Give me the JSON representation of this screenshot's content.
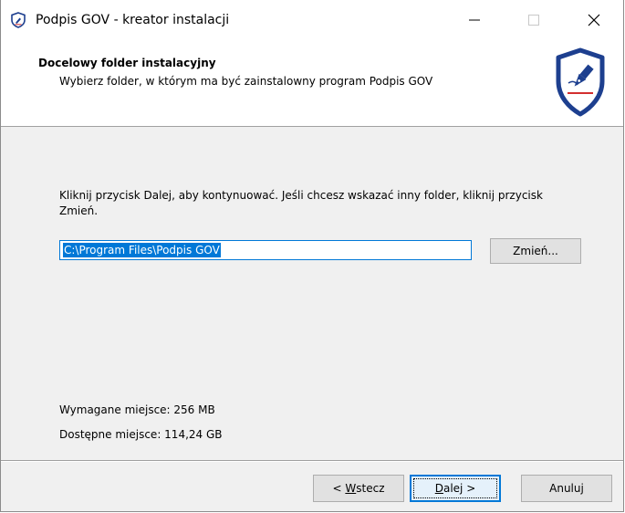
{
  "window": {
    "title": "Podpis GOV - kreator instalacji",
    "minimize_glyph": "—",
    "maximize_glyph": "☐",
    "close_glyph": "✕"
  },
  "header": {
    "title": "Docelowy folder instalacyjny",
    "subtitle": "Wybierz folder, w którym ma być zainstalowny program Podpis GOV",
    "logo_icon": "shield-pen-icon"
  },
  "content": {
    "instruction": "Kliknij przycisk Dalej, aby kontynuować. Jeśli chcesz wskazać inny folder, kliknij przycisk Zmień.",
    "install_path": "C:\\Program Files\\Podpis GOV",
    "change_button": "Zmień...",
    "space_required": "Wymagane miejsce: 256 MB",
    "space_available": "Dostępne miejsce: 114,24 GB"
  },
  "footer": {
    "back_prefix": "< ",
    "back_access": "W",
    "back_rest": "stecz",
    "next_access": "D",
    "next_rest": "alej >",
    "cancel": "Anuluj"
  },
  "colors": {
    "accent": "#0078d7",
    "shield_blue": "#1d3f8f",
    "shield_red": "#d32f2f"
  }
}
